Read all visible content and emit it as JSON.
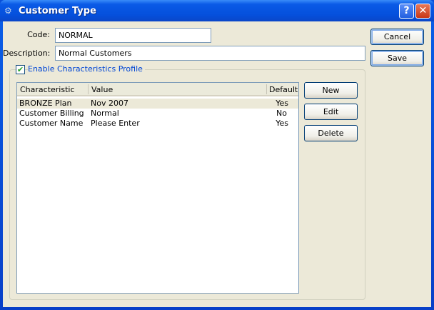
{
  "window": {
    "title": "Customer Type"
  },
  "form": {
    "code_label": "Code:",
    "code_value": "NORMAL",
    "description_label": "Description:",
    "description_value": "Normal Customers",
    "enable_label": "Enable Characteristics Profile",
    "enable_checked": true
  },
  "buttons": {
    "cancel": "Cancel",
    "save": "Save",
    "new": "New",
    "edit": "Edit",
    "delete": "Delete"
  },
  "table": {
    "columns": [
      "Characteristic",
      "Value",
      "Default"
    ],
    "rows": [
      {
        "characteristic": "BRONZE Plan",
        "value": "Nov 2007",
        "default": "Yes"
      },
      {
        "characteristic": "Customer Billing",
        "value": "Normal",
        "default": "No"
      },
      {
        "characteristic": "Customer Name",
        "value": "Please Enter",
        "default": "Yes"
      }
    ]
  }
}
